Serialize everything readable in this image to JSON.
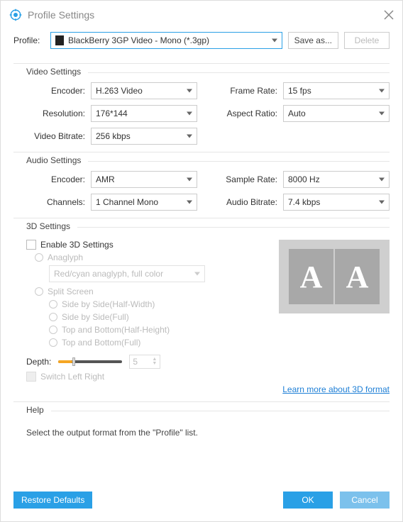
{
  "window": {
    "title": "Profile Settings"
  },
  "profile": {
    "label": "Profile:",
    "value": "BlackBerry 3GP Video - Mono (*.3gp)",
    "saveAs": "Save as...",
    "delete": "Delete"
  },
  "videoSettings": {
    "title": "Video Settings",
    "encoder": {
      "label": "Encoder:",
      "value": "H.263 Video"
    },
    "resolution": {
      "label": "Resolution:",
      "value": "176*144"
    },
    "bitrate": {
      "label": "Video Bitrate:",
      "value": "256 kbps"
    },
    "frameRate": {
      "label": "Frame Rate:",
      "value": "15 fps"
    },
    "aspect": {
      "label": "Aspect Ratio:",
      "value": "Auto"
    }
  },
  "audioSettings": {
    "title": "Audio Settings",
    "encoder": {
      "label": "Encoder:",
      "value": "AMR"
    },
    "channels": {
      "label": "Channels:",
      "value": "1 Channel Mono"
    },
    "sampleRate": {
      "label": "Sample Rate:",
      "value": "8000 Hz"
    },
    "bitrate": {
      "label": "Audio Bitrate:",
      "value": "7.4 kbps"
    }
  },
  "threeD": {
    "title": "3D Settings",
    "enable": "Enable 3D Settings",
    "anaglyph": {
      "label": "Anaglyph",
      "value": "Red/cyan anaglyph, full color"
    },
    "split": {
      "label": "Split Screen",
      "opts": [
        "Side by Side(Half-Width)",
        "Side by Side(Full)",
        "Top and Bottom(Half-Height)",
        "Top and Bottom(Full)"
      ]
    },
    "depth": {
      "label": "Depth:",
      "value": "5"
    },
    "switch": "Switch Left Right",
    "learn": "Learn more about 3D format"
  },
  "help": {
    "title": "Help",
    "text": "Select the output format from the \"Profile\" list."
  },
  "footer": {
    "restore": "Restore Defaults",
    "ok": "OK",
    "cancel": "Cancel"
  }
}
